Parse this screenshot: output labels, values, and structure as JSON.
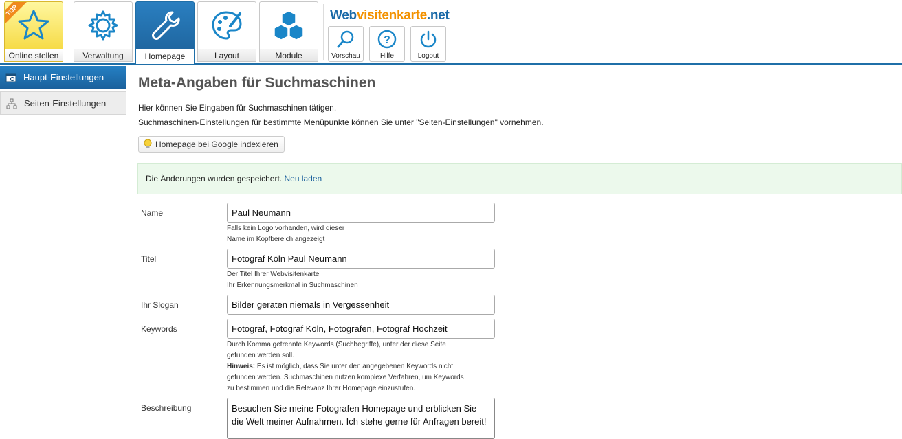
{
  "nav": {
    "tabs": [
      {
        "label": "Online stellen",
        "badge": "TOP",
        "icon": "star-icon"
      },
      {
        "label": "Verwaltung",
        "icon": "gear-icon"
      },
      {
        "label": "Homepage",
        "icon": "wrench-icon",
        "active": true
      },
      {
        "label": "Layout",
        "icon": "palette-icon"
      },
      {
        "label": "Module",
        "icon": "cubes-icon"
      }
    ],
    "logo": {
      "part1": "Web",
      "part2": "visitenkarte",
      "part3": ".net"
    },
    "actions": [
      {
        "label": "Vorschau",
        "icon": "magnifier-icon"
      },
      {
        "label": "Hilfe",
        "icon": "help-icon"
      },
      {
        "label": "Logout",
        "icon": "power-icon"
      }
    ]
  },
  "sidebar": {
    "items": [
      {
        "label": "Haupt-Einstellungen",
        "icon": "settings-window-icon",
        "active": true
      },
      {
        "label": "Seiten-Einstellungen",
        "icon": "sitemap-icon",
        "active": false
      }
    ]
  },
  "main": {
    "title": "Meta-Angaben für Suchmaschinen",
    "intro1": "Hier können Sie Eingaben für Suchmaschinen tätigen.",
    "intro2": "Suchmaschinen-Einstellungen für bestimmte Menüpunkte können Sie unter \"Seiten-Einstellungen\" vornehmen.",
    "google_button": "Homepage bei Google indexieren",
    "success_text": "Die Änderungen wurden gespeichert.",
    "success_link": "Neu laden",
    "fields": {
      "name": {
        "label": "Name",
        "value": "Paul Neumann",
        "hint1": "Falls kein Logo vorhanden, wird dieser",
        "hint2": "Name im Kopfbereich angezeigt"
      },
      "titel": {
        "label": "Titel",
        "value": "Fotograf Köln Paul Neumann",
        "hint1": "Der Titel Ihrer Webvisitenkarte",
        "hint2": "Ihr Erkennungsmerkmal in Suchmaschinen"
      },
      "slogan": {
        "label": "Ihr Slogan",
        "value": "Bilder geraten niemals in Vergessenheit"
      },
      "keywords": {
        "label": "Keywords",
        "value": "Fotograf, Fotograf Köln, Fotografen, Fotograf Hochzeit",
        "hint1": "Durch Komma getrennte Keywords (Suchbegriffe), unter der diese Seite",
        "hint2": "gefunden werden soll.",
        "hint_bold": "Hinweis:",
        "hint3": " Es ist möglich, dass Sie unter den angegebenen Keywords nicht",
        "hint4": "gefunden werden. Suchmaschinen nutzen komplexe Verfahren, um Keywords",
        "hint5": "zu bestimmen und die Relevanz Ihrer Homepage einzustufen."
      },
      "beschreibung": {
        "label": "Beschreibung",
        "value": "Besuchen Sie meine Fotografen Homepage und erblicken Sie die Welt meiner Aufnahmen. Ich stehe gerne für Anfragen bereit!"
      }
    }
  },
  "colors": {
    "primary_blue": "#1f6fa8",
    "logo_orange": "#f39200",
    "success_bg": "#ecf9ec"
  }
}
